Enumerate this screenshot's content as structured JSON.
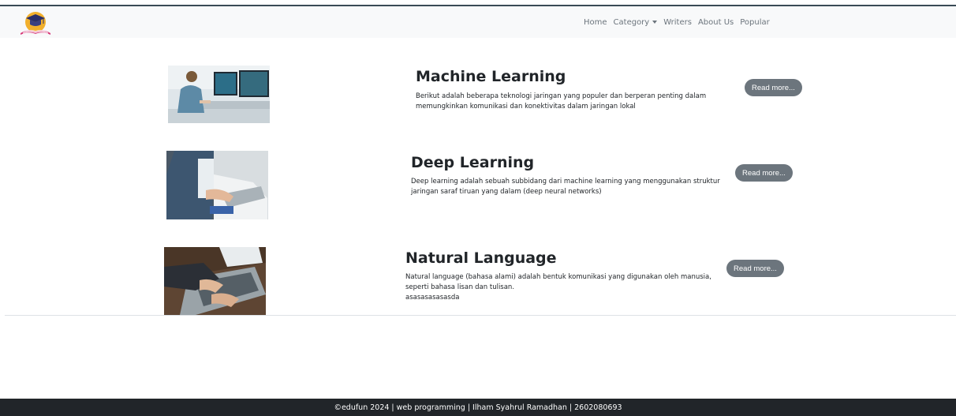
{
  "nav": {
    "logo_icon": "graduation-book-logo",
    "items": [
      "Home",
      "Category",
      "Writers",
      "About Us",
      "Popular"
    ]
  },
  "articles": [
    {
      "title": "Machine Learning",
      "description": "Berikut adalah beberapa teknologi jaringan yang populer dan berperan penting dalam memungkinkan komunikasi dan konektivitas dalam jaringan lokal",
      "button": "Read more..."
    },
    {
      "title": "Deep Learning",
      "description": "Deep learning adalah sebuah subbidang dari machine learning yang menggunakan struktur jaringan saraf tiruan yang dalam (deep neural networks)",
      "button": "Read more..."
    },
    {
      "title": "Natural Language",
      "description": "Natural language (bahasa alami) adalah bentuk komunikasi yang digunakan oleh manusia, seperti bahasa lisan dan tulisan.",
      "extra": "asasasasasasda",
      "button": "Read more..."
    }
  ],
  "footer": {
    "text": "©edufun 2024 | web programming | Ilham Syahrul Ramadhan | 2602080693"
  },
  "colors": {
    "navbar_bg": "#f8f9fa",
    "button_bg": "#6c757d",
    "footer_bg": "#212529"
  }
}
